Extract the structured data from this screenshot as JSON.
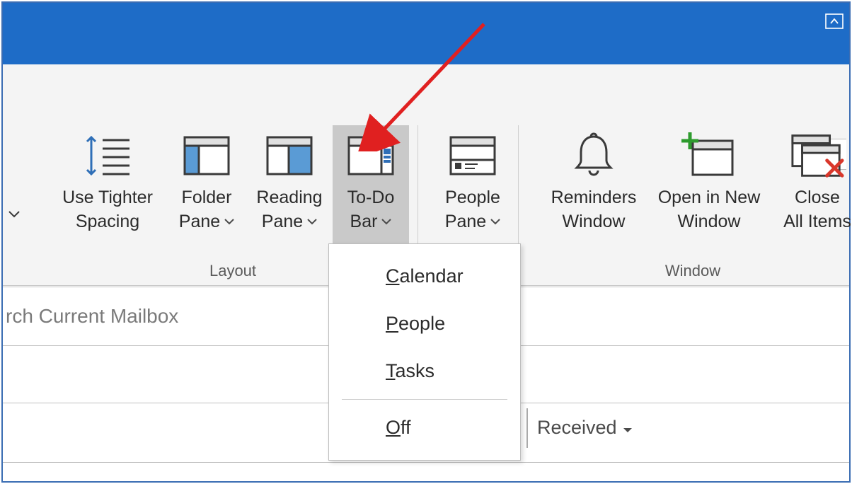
{
  "ribbon": {
    "groups": {
      "layout": {
        "label": "Layout",
        "buttons": {
          "use_tighter_spacing": {
            "line1": "Use Tighter",
            "line2": "Spacing"
          },
          "folder_pane": {
            "line1": "Folder",
            "line2": "Pane"
          },
          "reading_pane": {
            "line1": "Reading",
            "line2": "Pane"
          },
          "todo_bar": {
            "line1": "To-Do",
            "line2": "Bar"
          }
        }
      },
      "people": {
        "label": "",
        "buttons": {
          "people_pane": {
            "line1": "People",
            "line2": "Pane"
          }
        }
      },
      "window": {
        "label": "Window",
        "buttons": {
          "reminders_window": {
            "line1": "Reminders",
            "line2": "Window"
          },
          "open_new_window": {
            "line1": "Open in New",
            "line2": "Window"
          },
          "close_all_items": {
            "line1": "Close",
            "line2": "All Items"
          }
        }
      }
    }
  },
  "todo_menu": {
    "items": [
      "Calendar",
      "People",
      "Tasks"
    ],
    "off": "Off"
  },
  "search": {
    "placeholder": "rch Current Mailbox"
  },
  "headers": {
    "received": "Received"
  }
}
